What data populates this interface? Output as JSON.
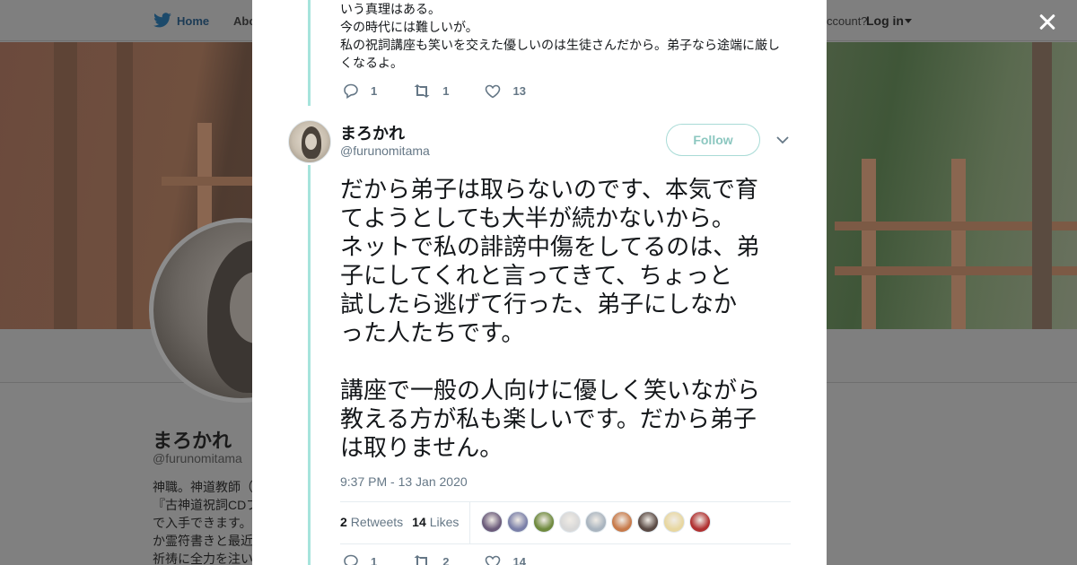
{
  "nav": {
    "home_label": "Home",
    "about_label": "Abo",
    "account_text": "ccount?",
    "login_label": "Log in"
  },
  "profile": {
    "name": "まろかれ",
    "handle": "@furunomitama",
    "bio": "神職。神道教師（\n『古神道祝詞CDブ\nで入手できます。\nか霊符書きと最近\n祈祷に全力を注い"
  },
  "previous_tweet": {
    "lines": [
      "いう真理はある。",
      "今の時代には難しいが。",
      "私の祝詞講座も笑いを交えた優しいのは生徒さんだから。弟子なら途端に厳し",
      "くなるよ。"
    ],
    "replies": "1",
    "retweets": "1",
    "likes": "13"
  },
  "tweet": {
    "author_name": "まろかれ",
    "author_handle": "@furunomitama",
    "follow_label": "Follow",
    "text_lines_1": [
      "だから弟子は取らないのです、本気で育",
      "てようとしても大半が続かないから。",
      "ネットで私の誹謗中傷をしてるのは、弟",
      "子にしてくれと言ってきて、ちょっと",
      "試したら逃げて行った、弟子にしなか",
      "った人たちです。"
    ],
    "text_lines_2": [
      "講座で一般の人向けに優しく笑いながら",
      "教える方が私も楽しいです。だから弟子",
      "は取りません。"
    ],
    "timestamp": "9:37 PM - 13 Jan 2020",
    "retweet_count": "2",
    "retweet_label": "Retweets",
    "like_count": "14",
    "like_label": "Likes",
    "likers": [
      "#6b5b7a",
      "#7a7fa8",
      "#6f8a3e",
      "#d8d8d8",
      "#a9b4bf",
      "#c77a4a",
      "#5a4a44",
      "#e8d7a0",
      "#b03030"
    ],
    "replies": "1",
    "retweets": "2",
    "likes": "14"
  },
  "colors": {
    "follow_accent": "#8cc7c0",
    "thread_line": "#a6e4dc",
    "meta_gray": "#657786"
  }
}
